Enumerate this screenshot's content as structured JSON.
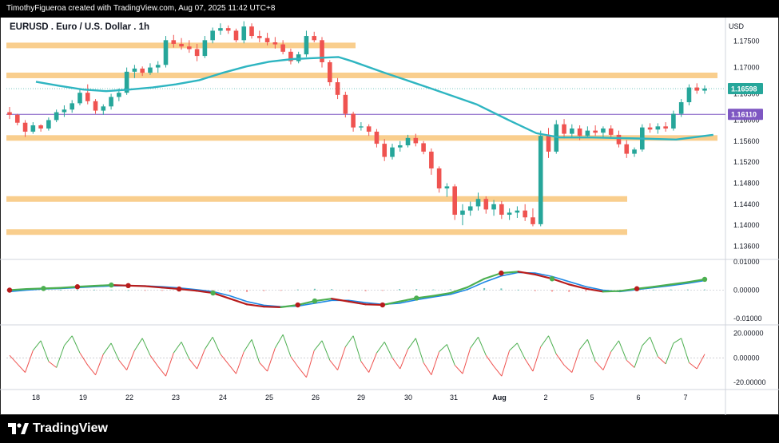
{
  "header": {
    "attribution": "TimothyFigueroa created with TradingView.com, Aug 07, 2025 11:42 UTC+8",
    "title": "EURUSD . Euro / U.S. Dollar . 1h",
    "currency": "USD"
  },
  "footer": {
    "brand": "TradingView",
    "brand_icon": "tradingview-logo-icon"
  },
  "colors": {
    "up": "#26a69a",
    "down": "#ef5350",
    "ma": "#2eb5c1",
    "zone": "#f8c981",
    "purple": "#7e57c2",
    "macd_fast": "#4caf50",
    "macd_slow": "#1e88e5",
    "macd_down": "#b71c1c",
    "osc_up": "#4caf50",
    "osc_down": "#ef5350"
  },
  "chart_data": [
    {
      "type": "candlestick",
      "title": "EURUSD . Euro / U.S. Dollar . 1h",
      "x_tick_labels": [
        "18",
        "19",
        "22",
        "23",
        "24",
        "25",
        "26",
        "29",
        "30",
        "31",
        "Aug",
        "2",
        "5",
        "6",
        "7"
      ],
      "y_tick_labels": [
        "1.17500",
        "1.17000",
        "1.16500",
        "1.16000",
        "1.15600",
        "1.15200",
        "1.14800",
        "1.14400",
        "1.14000",
        "1.13600"
      ],
      "ylim": [
        1.1335,
        1.1795
      ],
      "price_labels": [
        {
          "value": 1.16598,
          "label": "1.16598",
          "color": "#26a69a"
        },
        {
          "value": 1.1611,
          "label": "1.16110",
          "color": "#7e57c2"
        }
      ],
      "zones": [
        {
          "y": 1.1742,
          "x_range": [
            "18",
            "26"
          ]
        },
        {
          "y": 1.1685,
          "x_range": [
            "18",
            "7"
          ]
        },
        {
          "y": 1.1566,
          "x_range": [
            "18",
            "7"
          ]
        },
        {
          "y": 1.145,
          "x_range": [
            "18",
            "6"
          ]
        },
        {
          "y": 1.1387,
          "x_range": [
            "18",
            "6"
          ]
        }
      ],
      "horizontal_line": {
        "y": 1.1611
      },
      "moving_average": [
        {
          "x": 0.0,
          "y": 1.1673
        },
        {
          "x": 0.5,
          "y": 1.1665
        },
        {
          "x": 1.0,
          "y": 1.1658
        },
        {
          "x": 1.5,
          "y": 1.1655
        },
        {
          "x": 2.0,
          "y": 1.1658
        },
        {
          "x": 2.5,
          "y": 1.1662
        },
        {
          "x": 3.0,
          "y": 1.1668
        },
        {
          "x": 3.5,
          "y": 1.1676
        },
        {
          "x": 4.0,
          "y": 1.169
        },
        {
          "x": 4.5,
          "y": 1.1702
        },
        {
          "x": 5.0,
          "y": 1.1711
        },
        {
          "x": 5.5,
          "y": 1.1716
        },
        {
          "x": 6.0,
          "y": 1.1718
        },
        {
          "x": 6.5,
          "y": 1.172
        },
        {
          "x": 6.8,
          "y": 1.1712
        },
        {
          "x": 7.5,
          "y": 1.169
        },
        {
          "x": 8.5,
          "y": 1.166
        },
        {
          "x": 9.5,
          "y": 1.163
        },
        {
          "x": 10.2,
          "y": 1.16
        },
        {
          "x": 10.8,
          "y": 1.1575
        },
        {
          "x": 11.3,
          "y": 1.1567
        },
        {
          "x": 12.0,
          "y": 1.1567
        },
        {
          "x": 13.0,
          "y": 1.1565
        },
        {
          "x": 13.8,
          "y": 1.1563
        },
        {
          "x": 14.6,
          "y": 1.1572
        }
      ],
      "candles": [
        [
          1.1615,
          1.1625,
          1.1602,
          1.161
        ],
        [
          1.161,
          1.1612,
          1.159,
          1.1595
        ],
        [
          1.1595,
          1.16,
          1.1568,
          1.1578
        ],
        [
          1.1578,
          1.1596,
          1.1574,
          1.159
        ],
        [
          1.159,
          1.1592,
          1.1578,
          1.1584
        ],
        [
          1.1584,
          1.1605,
          1.158,
          1.16
        ],
        [
          1.16,
          1.162,
          1.1596,
          1.1615
        ],
        [
          1.1615,
          1.1628,
          1.1606,
          1.162
        ],
        [
          1.162,
          1.1638,
          1.1614,
          1.1632
        ],
        [
          1.1632,
          1.166,
          1.1628,
          1.1652
        ],
        [
          1.1652,
          1.1668,
          1.163,
          1.1636
        ],
        [
          1.1636,
          1.164,
          1.1612,
          1.1618
        ],
        [
          1.1618,
          1.163,
          1.161,
          1.1626
        ],
        [
          1.1626,
          1.165,
          1.162,
          1.1644
        ],
        [
          1.1644,
          1.166,
          1.1636,
          1.1652
        ],
        [
          1.1652,
          1.17,
          1.1648,
          1.1692
        ],
        [
          1.1692,
          1.1705,
          1.168,
          1.1698
        ],
        [
          1.1698,
          1.1702,
          1.1684,
          1.169
        ],
        [
          1.169,
          1.1708,
          1.1686,
          1.17
        ],
        [
          1.17,
          1.1712,
          1.169,
          1.1705
        ],
        [
          1.1705,
          1.176,
          1.17,
          1.1752
        ],
        [
          1.1752,
          1.1762,
          1.1738,
          1.1745
        ],
        [
          1.1745,
          1.1756,
          1.1734,
          1.174
        ],
        [
          1.174,
          1.1752,
          1.1728,
          1.1735
        ],
        [
          1.1735,
          1.1745,
          1.1712,
          1.1722
        ],
        [
          1.1722,
          1.176,
          1.1718,
          1.1752
        ],
        [
          1.1752,
          1.1776,
          1.1746,
          1.177
        ],
        [
          1.177,
          1.1784,
          1.1762,
          1.1775
        ],
        [
          1.1775,
          1.178,
          1.1764,
          1.177
        ],
        [
          1.177,
          1.1774,
          1.1748,
          1.1752
        ],
        [
          1.1752,
          1.1788,
          1.1746,
          1.1778
        ],
        [
          1.1778,
          1.1784,
          1.1755,
          1.176
        ],
        [
          1.176,
          1.177,
          1.1748,
          1.1756
        ],
        [
          1.1756,
          1.1766,
          1.1742,
          1.1748
        ],
        [
          1.1748,
          1.1758,
          1.1736,
          1.1744
        ],
        [
          1.1744,
          1.1752,
          1.1725,
          1.173
        ],
        [
          1.173,
          1.1736,
          1.1706,
          1.1712
        ],
        [
          1.1712,
          1.173,
          1.1708,
          1.1725
        ],
        [
          1.1725,
          1.177,
          1.172,
          1.176
        ],
        [
          1.176,
          1.1768,
          1.1748,
          1.1752
        ],
        [
          1.1752,
          1.1758,
          1.17,
          1.171
        ],
        [
          1.171,
          1.1714,
          1.1665,
          1.1672
        ],
        [
          1.1672,
          1.168,
          1.164,
          1.1648
        ],
        [
          1.1648,
          1.1654,
          1.1605,
          1.1612
        ],
        [
          1.1612,
          1.1616,
          1.1578,
          1.1586
        ],
        [
          1.1586,
          1.1596,
          1.158,
          1.1588
        ],
        [
          1.1588,
          1.1592,
          1.157,
          1.1578
        ],
        [
          1.1578,
          1.1583,
          1.1548,
          1.1555
        ],
        [
          1.1555,
          1.1564,
          1.1522,
          1.153
        ],
        [
          1.153,
          1.1555,
          1.1525,
          1.1548
        ],
        [
          1.1548,
          1.156,
          1.154,
          1.1552
        ],
        [
          1.1552,
          1.1572,
          1.1548,
          1.1566
        ],
        [
          1.1566,
          1.1574,
          1.155,
          1.1556
        ],
        [
          1.1556,
          1.156,
          1.1535,
          1.154
        ],
        [
          1.154,
          1.1546,
          1.1496,
          1.1508
        ],
        [
          1.1508,
          1.1512,
          1.1462,
          1.147
        ],
        [
          1.147,
          1.148,
          1.1454,
          1.1474
        ],
        [
          1.1474,
          1.1478,
          1.141,
          1.142
        ],
        [
          1.142,
          1.144,
          1.14,
          1.1428
        ],
        [
          1.1428,
          1.1445,
          1.1418,
          1.1436
        ],
        [
          1.1436,
          1.1462,
          1.1428,
          1.145
        ],
        [
          1.145,
          1.1455,
          1.1422,
          1.143
        ],
        [
          1.143,
          1.1448,
          1.1418,
          1.144
        ],
        [
          1.144,
          1.1446,
          1.1412,
          1.142
        ],
        [
          1.142,
          1.1432,
          1.141,
          1.1424
        ],
        [
          1.1424,
          1.1436,
          1.1414,
          1.1428
        ],
        [
          1.1428,
          1.144,
          1.1408,
          1.1415
        ],
        [
          1.1415,
          1.1432,
          1.1398,
          1.1402
        ],
        [
          1.1402,
          1.158,
          1.1398,
          1.157
        ],
        [
          1.157,
          1.1585,
          1.1528,
          1.154
        ],
        [
          1.154,
          1.16,
          1.1536,
          1.1592
        ],
        [
          1.1592,
          1.1602,
          1.1565,
          1.1574
        ],
        [
          1.1574,
          1.1592,
          1.1566,
          1.1584
        ],
        [
          1.1584,
          1.159,
          1.1562,
          1.157
        ],
        [
          1.157,
          1.1588,
          1.1566,
          1.158
        ],
        [
          1.158,
          1.159,
          1.157,
          1.1576
        ],
        [
          1.1576,
          1.1588,
          1.1568,
          1.1584
        ],
        [
          1.1584,
          1.159,
          1.1566,
          1.1572
        ],
        [
          1.1572,
          1.158,
          1.1548,
          1.1554
        ],
        [
          1.1554,
          1.1562,
          1.1528,
          1.1536
        ],
        [
          1.1536,
          1.1548,
          1.153,
          1.1544
        ],
        [
          1.1544,
          1.1592,
          1.154,
          1.1586
        ],
        [
          1.1586,
          1.1594,
          1.1576,
          1.1582
        ],
        [
          1.1582,
          1.1594,
          1.1574,
          1.1588
        ],
        [
          1.1588,
          1.1596,
          1.1578,
          1.1584
        ],
        [
          1.1584,
          1.1618,
          1.158,
          1.1612
        ],
        [
          1.1612,
          1.164,
          1.1606,
          1.1634
        ],
        [
          1.1634,
          1.1668,
          1.1628,
          1.1662
        ],
        [
          1.1662,
          1.167,
          1.165,
          1.1656
        ],
        [
          1.1656,
          1.1666,
          1.165,
          1.166
        ]
      ]
    },
    {
      "type": "line",
      "y_tick_labels": [
        "0.01000",
        "0.00000",
        "-0.01000"
      ],
      "ylim": [
        -0.0122,
        0.0108
      ],
      "fast_line": [
        0.0,
        0.0004,
        0.0006,
        0.0008,
        0.0012,
        0.0015,
        0.0018,
        0.0016,
        0.0014,
        0.0009,
        0.0004,
        -0.0002,
        -0.001,
        -0.003,
        -0.005,
        -0.0058,
        -0.006,
        -0.0052,
        -0.0038,
        -0.003,
        -0.004,
        -0.005,
        -0.0052,
        -0.004,
        -0.0028,
        -0.002,
        -0.001,
        0.001,
        0.004,
        0.006,
        0.0065,
        0.0055,
        0.004,
        0.002,
        0.0005,
        -0.0005,
        -0.0003,
        0.0005,
        0.0012,
        0.002,
        0.0028,
        0.0038
      ],
      "slow_line": [
        -0.0005,
        0.0,
        0.0004,
        0.0006,
        0.0009,
        0.0012,
        0.0015,
        0.0016,
        0.0015,
        0.0012,
        0.0008,
        0.0002,
        -0.0005,
        -0.002,
        -0.004,
        -0.0053,
        -0.0058,
        -0.0056,
        -0.0046,
        -0.0036,
        -0.0036,
        -0.0044,
        -0.005,
        -0.0046,
        -0.0034,
        -0.0024,
        -0.0015,
        0.0002,
        0.0028,
        0.005,
        0.0062,
        0.006,
        0.0048,
        0.003,
        0.0012,
        0.0,
        -0.0005,
        0.0002,
        0.0009,
        0.0016,
        0.0024,
        0.0034
      ],
      "cross_markers": [
        {
          "i": 1,
          "dir": "down"
        },
        {
          "i": 5,
          "dir": "up"
        },
        {
          "i": 9,
          "dir": "down"
        },
        {
          "i": 13,
          "dir": "up"
        },
        {
          "i": 16,
          "dir": "down"
        },
        {
          "i": 22,
          "dir": "down"
        },
        {
          "i": 27,
          "dir": "up"
        },
        {
          "i": 36,
          "dir": "down"
        },
        {
          "i": 40,
          "dir": "up"
        },
        {
          "i": 47,
          "dir": "down"
        },
        {
          "i": 53,
          "dir": "up"
        },
        {
          "i": 62,
          "dir": "down"
        },
        {
          "i": 70,
          "dir": "up"
        },
        {
          "i": 81,
          "dir": "down"
        },
        {
          "i": 88,
          "dir": "up"
        }
      ]
    },
    {
      "type": "line",
      "y_tick_labels": [
        "20.00000",
        "0.00000",
        "-20.00000"
      ],
      "ylim": [
        -26,
        27
      ],
      "values": [
        2,
        -5,
        -12,
        6,
        14,
        -3,
        -8,
        10,
        18,
        4,
        -6,
        -14,
        3,
        12,
        -2,
        -10,
        6,
        16,
        2,
        -7,
        -15,
        4,
        13,
        -1,
        -9,
        7,
        17,
        3,
        -5,
        -13,
        5,
        15,
        -4,
        -11,
        8,
        19,
        1,
        -8,
        -16,
        6,
        14,
        -2,
        -10,
        9,
        18,
        -3,
        -12,
        4,
        13,
        0,
        -9,
        7,
        16,
        -4,
        -14,
        5,
        11,
        -6,
        -13,
        8,
        17,
        2,
        -7,
        -15,
        6,
        12,
        -1,
        -11,
        9,
        18,
        3,
        -6,
        -12,
        7,
        15,
        -3,
        -10,
        5,
        14,
        -2,
        -8,
        10,
        17,
        1,
        -5,
        12,
        16,
        -4,
        -9,
        3
      ]
    }
  ]
}
